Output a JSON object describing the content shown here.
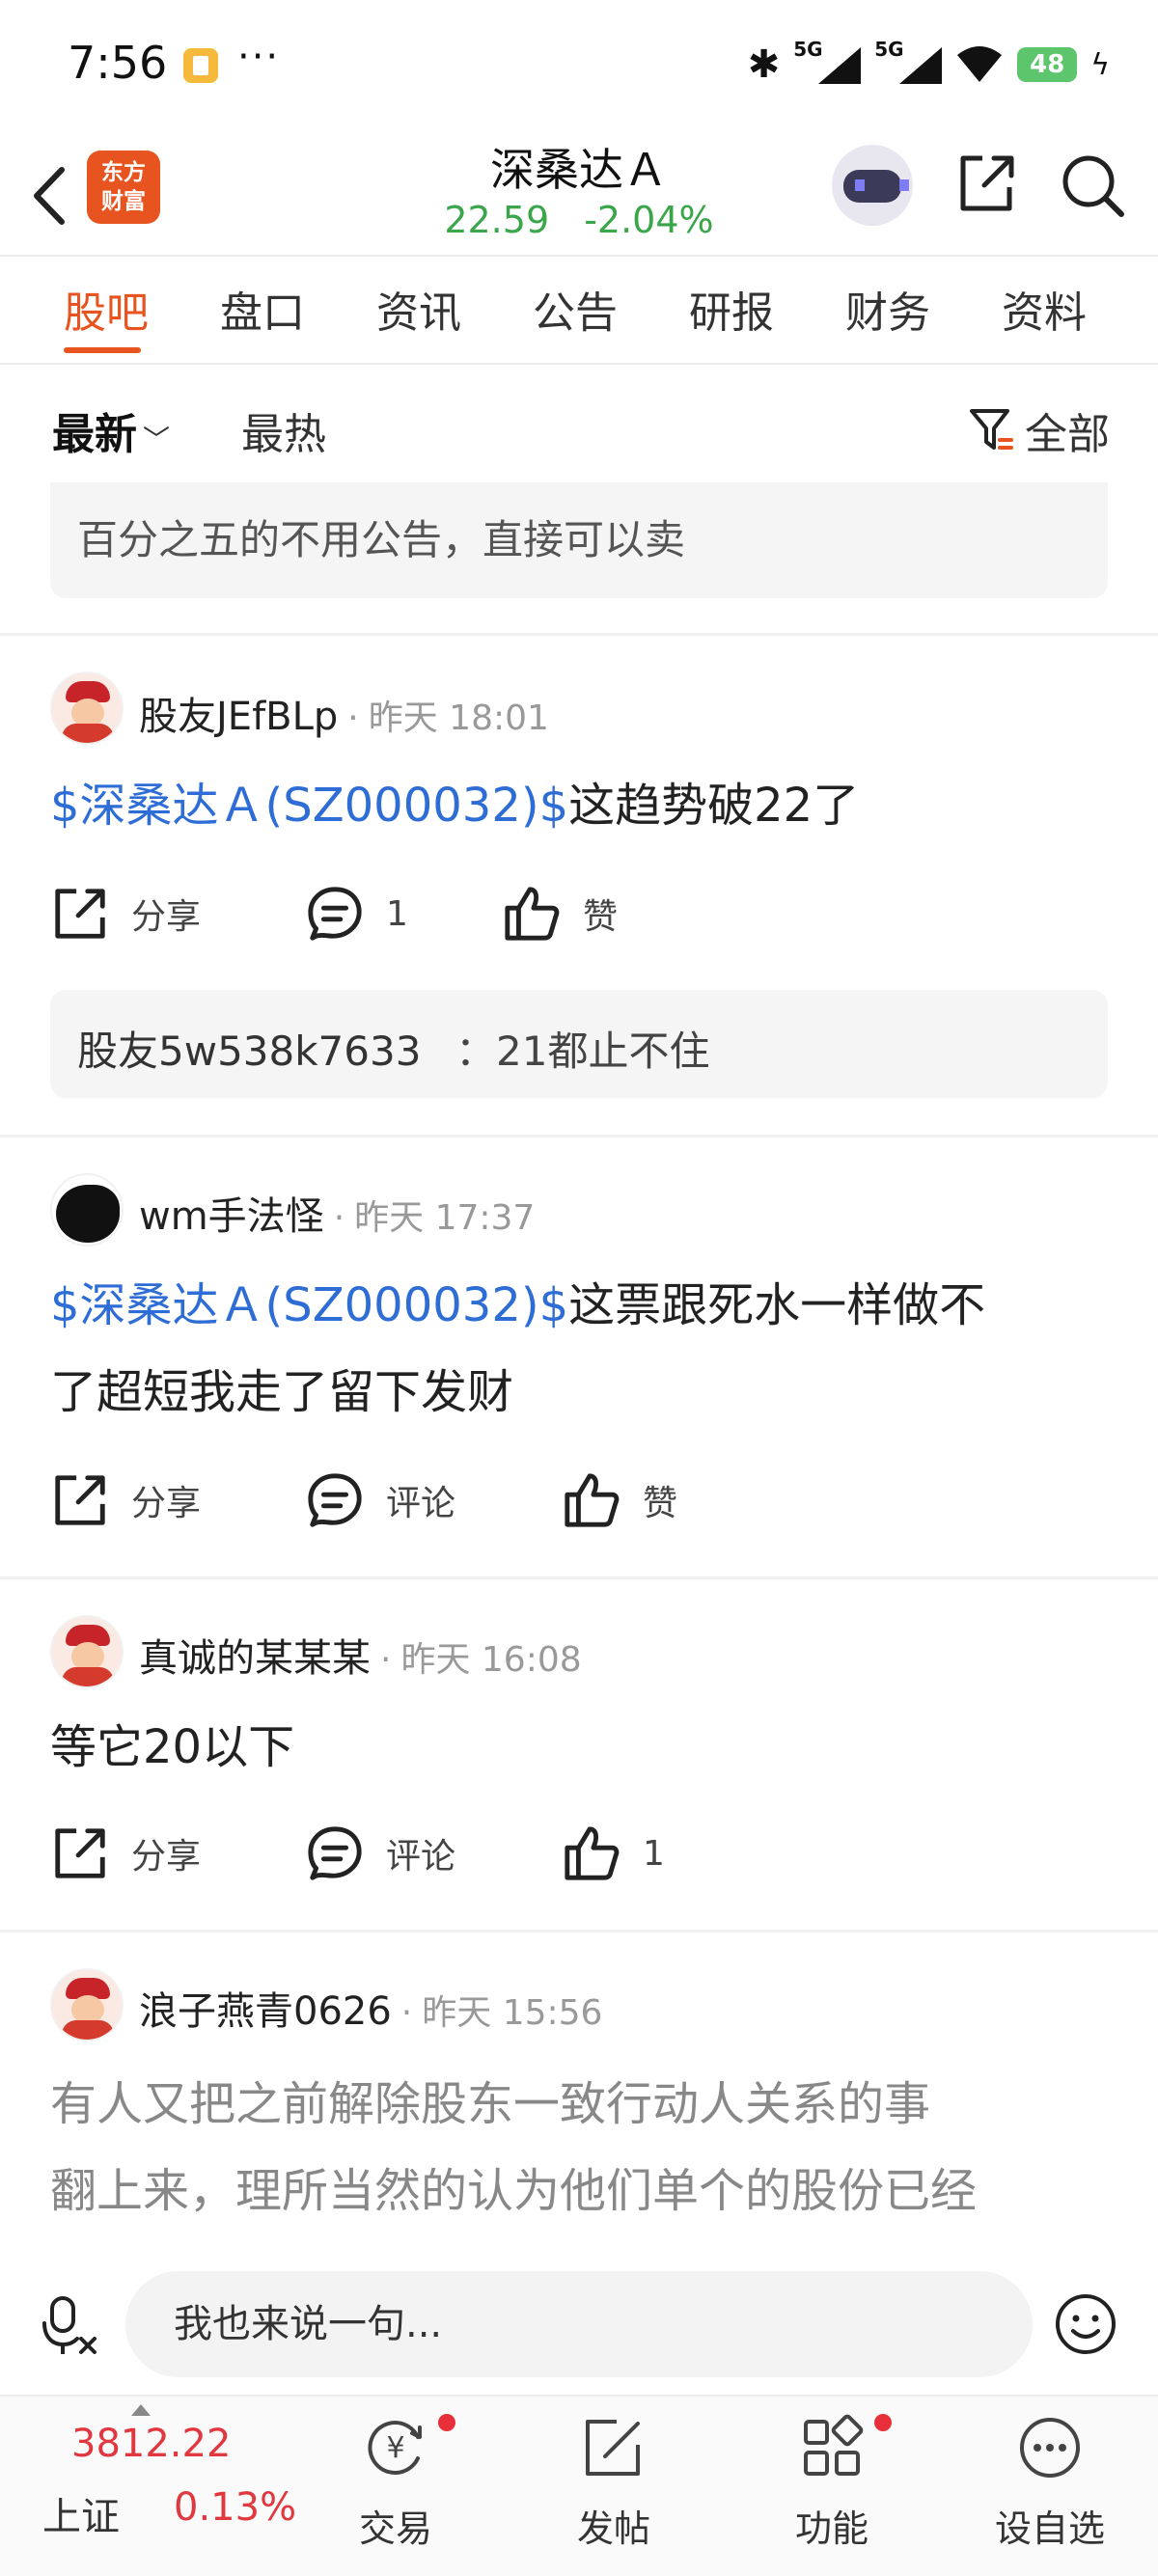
{
  "status_bar": {
    "time": "7:56",
    "dots": "···",
    "network": "5G",
    "battery": "48"
  },
  "header": {
    "logo_text_1": "东方",
    "logo_text_2": "财富",
    "stock_name": "深桑达Ａ",
    "price": "22.59",
    "change_pct": "-2.04%",
    "colors": {
      "brand": "#e8541f",
      "down": "#3aa54a",
      "up": "#e0383e",
      "link": "#2e6cd6"
    }
  },
  "tabs": [
    "股吧",
    "盘口",
    "资讯",
    "公告",
    "研报",
    "财务",
    "资料"
  ],
  "filters": {
    "latest": "最新",
    "hot": "最热",
    "all": "全部"
  },
  "feed": {
    "quote_preview": "百分之五的不用公告，直接可以卖",
    "posts": [
      {
        "user": "股友JEfBLp",
        "time": "昨天 18:01",
        "stock_tag": "$深桑达Ａ(SZ000032)$",
        "text": "这趋势破22了",
        "share": "分享",
        "comment": "1",
        "like": "赞",
        "reply_user": "股友5w538k7633",
        "reply_text": "：21都止不住"
      },
      {
        "user": "wm手法怪",
        "time": "昨天 17:37",
        "stock_tag": "$深桑达Ａ(SZ000032)$",
        "text": "这票跟死水一样做不",
        "text_line2": "了超短我走了留下发财",
        "share": "分享",
        "comment": "评论",
        "like": "赞"
      },
      {
        "user": "真诚的某某某",
        "time": "昨天 16:08",
        "text": "等它20以下",
        "share": "分享",
        "comment": "评论",
        "like": "1"
      },
      {
        "user": "浪子燕青0626",
        "time": "昨天 15:56",
        "text_line1": "有人又把之前解除股东一致行动人关系的事",
        "text_line2": "翻上来，理所当然的认为他们单个的股份已经"
      }
    ]
  },
  "input": {
    "placeholder": "我也来说一句..."
  },
  "bottom_nav": {
    "index_value": "3812.22",
    "index_name": "上证",
    "index_change": "0.13%",
    "items": [
      "交易",
      "发帖",
      "功能",
      "设自选"
    ]
  }
}
